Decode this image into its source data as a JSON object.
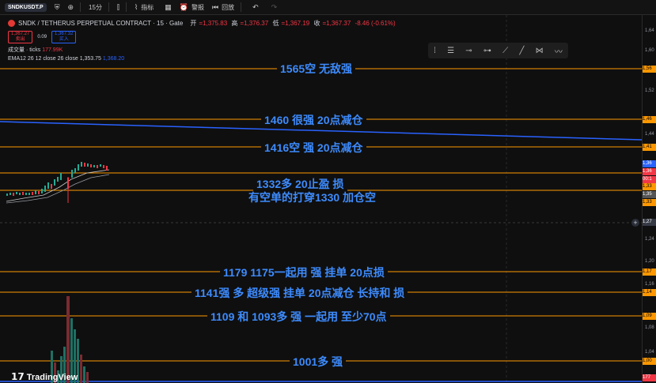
{
  "toolbar": {
    "symbol": "SNDKUSDT.P",
    "interval": "15分",
    "indicators": "指标",
    "alert": "警报",
    "replay": "回放"
  },
  "legend": {
    "title": "SNDK / TETHERUS PERPETUAL CONTRACT · 15 · Gate",
    "open_label": "开",
    "open": "=1,375.83",
    "high_label": "高",
    "high": "=1,376.37",
    "low_label": "低",
    "low": "=1,367.19",
    "close_label": "收",
    "close": "=1,367.37",
    "change": "-8.46 (-0.61%)",
    "sell_price": "1,367.27",
    "sell_label": "卖出",
    "spread": "0.09",
    "buy_price": "1,367.32",
    "buy_label": "买入",
    "volume": "成交量 · ticks",
    "volume_value": "177.99K",
    "ema": "EMA12 26 12 close 26 close",
    "ema_v1": "1,353.75",
    "ema_v2": "1,368.20"
  },
  "annotations": [
    {
      "text": "1565空 无敌强"
    },
    {
      "text": "1460 很强 20点减仓"
    },
    {
      "text": "1416空 强 20点减仓"
    },
    {
      "text": "1332多   20止盈  损"
    },
    {
      "text": "有空单的打穿1330 加仓空"
    },
    {
      "text": "1179 1175一起用 强  挂单 20点损"
    },
    {
      "text": "1141强 多  超级强 挂单  20点减仓 长持和 损"
    },
    {
      "text": "1109 和 1093多   强 一起用   至少70点"
    },
    {
      "text": "1001多 强"
    }
  ],
  "axis": {
    "labels": [
      "1,64",
      "1,60",
      "1,56",
      "1,52",
      "1,48",
      "1,44",
      "1,40",
      "1,36",
      "1,32",
      "1,27",
      "1,24",
      "1,20",
      "1,16",
      "1,12",
      "1,08",
      "1,04",
      "1,00"
    ],
    "tags": [
      "1,56",
      "1,46",
      "1,41",
      "1,36",
      "1,36",
      "00:1",
      "1,33",
      "1,35",
      "1,33",
      "1,17",
      "1,14",
      "1,09",
      "1,00",
      "177"
    ]
  },
  "brand": "TradingView",
  "colors": {
    "level_line": "#ff9800",
    "trend_line": "#2962ff",
    "annotation": "#3d8bfd"
  }
}
